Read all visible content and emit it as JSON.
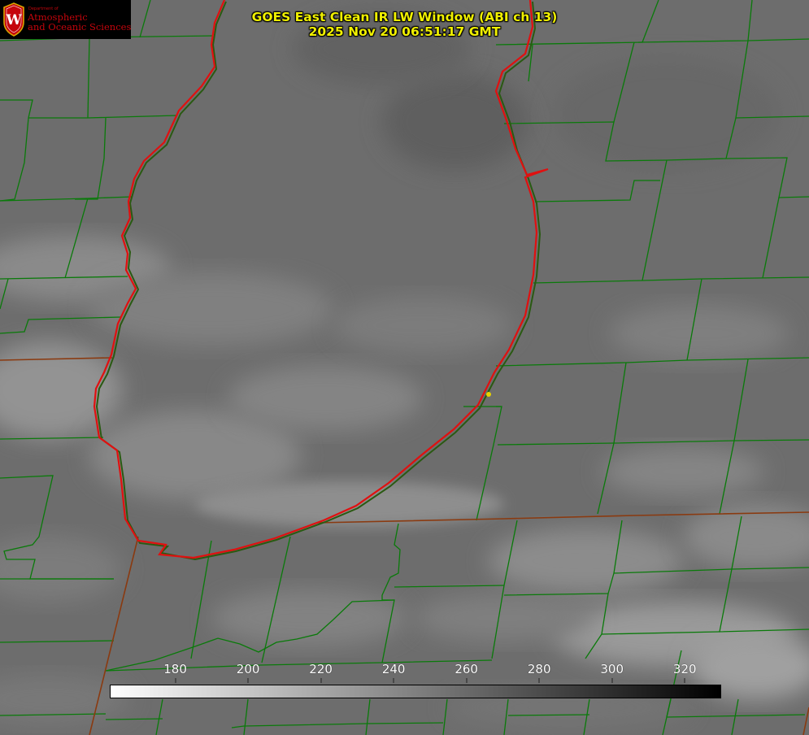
{
  "header": {
    "title": "GOES East Clean IR LW Window (ABI ch 13)",
    "timestamp": "2025 Nov 20 06:51:17 GMT"
  },
  "logo": {
    "crest_letter": "W",
    "department_label": "Department of",
    "line1": "Atmospheric",
    "line2": "and Oceanic Sciences"
  },
  "colors": {
    "background_gray": "#6e6e6e",
    "county_lines": "#0a7a0a",
    "state_lines": "#8a3a10",
    "lake_shoreline": "#e01010",
    "lake_coast_shadow": "#2a5a12",
    "title_text": "#f0f000",
    "logo_red": "#c5050c",
    "point_marker": "#e6d200"
  },
  "colorbar": {
    "min": 162,
    "max": 330,
    "ticks": [
      180,
      200,
      220,
      240,
      260,
      280,
      300,
      320
    ],
    "gradient_from": "#ffffff",
    "gradient_to": "#000000"
  },
  "icons": {
    "logo_crest": "uw-crest-icon",
    "point": "station-marker-icon"
  }
}
